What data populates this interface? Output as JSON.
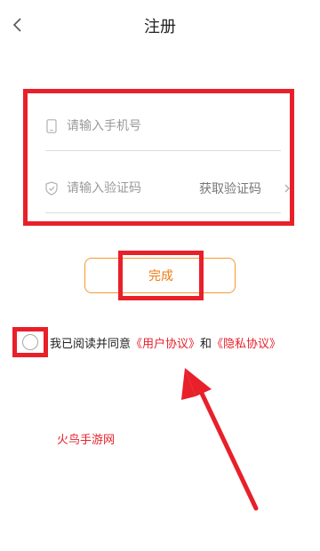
{
  "nav": {
    "title": "注册",
    "back_icon": "chevron-left-icon"
  },
  "form": {
    "phone": {
      "placeholder": "请输入手机号",
      "value": "",
      "icon": "phone-icon"
    },
    "code": {
      "placeholder": "请输入验证码",
      "value": "",
      "icon": "shield-icon"
    },
    "get_code_label": "获取验证码",
    "get_code_icon": "chevron-right-icon"
  },
  "submit": {
    "label": "完成",
    "color": "#f07a12"
  },
  "agreement": {
    "prefix": "我已阅读并同意",
    "user_agreement": "《用户协议》",
    "and": "和",
    "privacy_policy": "《隐私协议》",
    "checked": false
  },
  "watermark": "火鸟手游网",
  "annotations": {
    "highlight_color": "#e8202a"
  }
}
